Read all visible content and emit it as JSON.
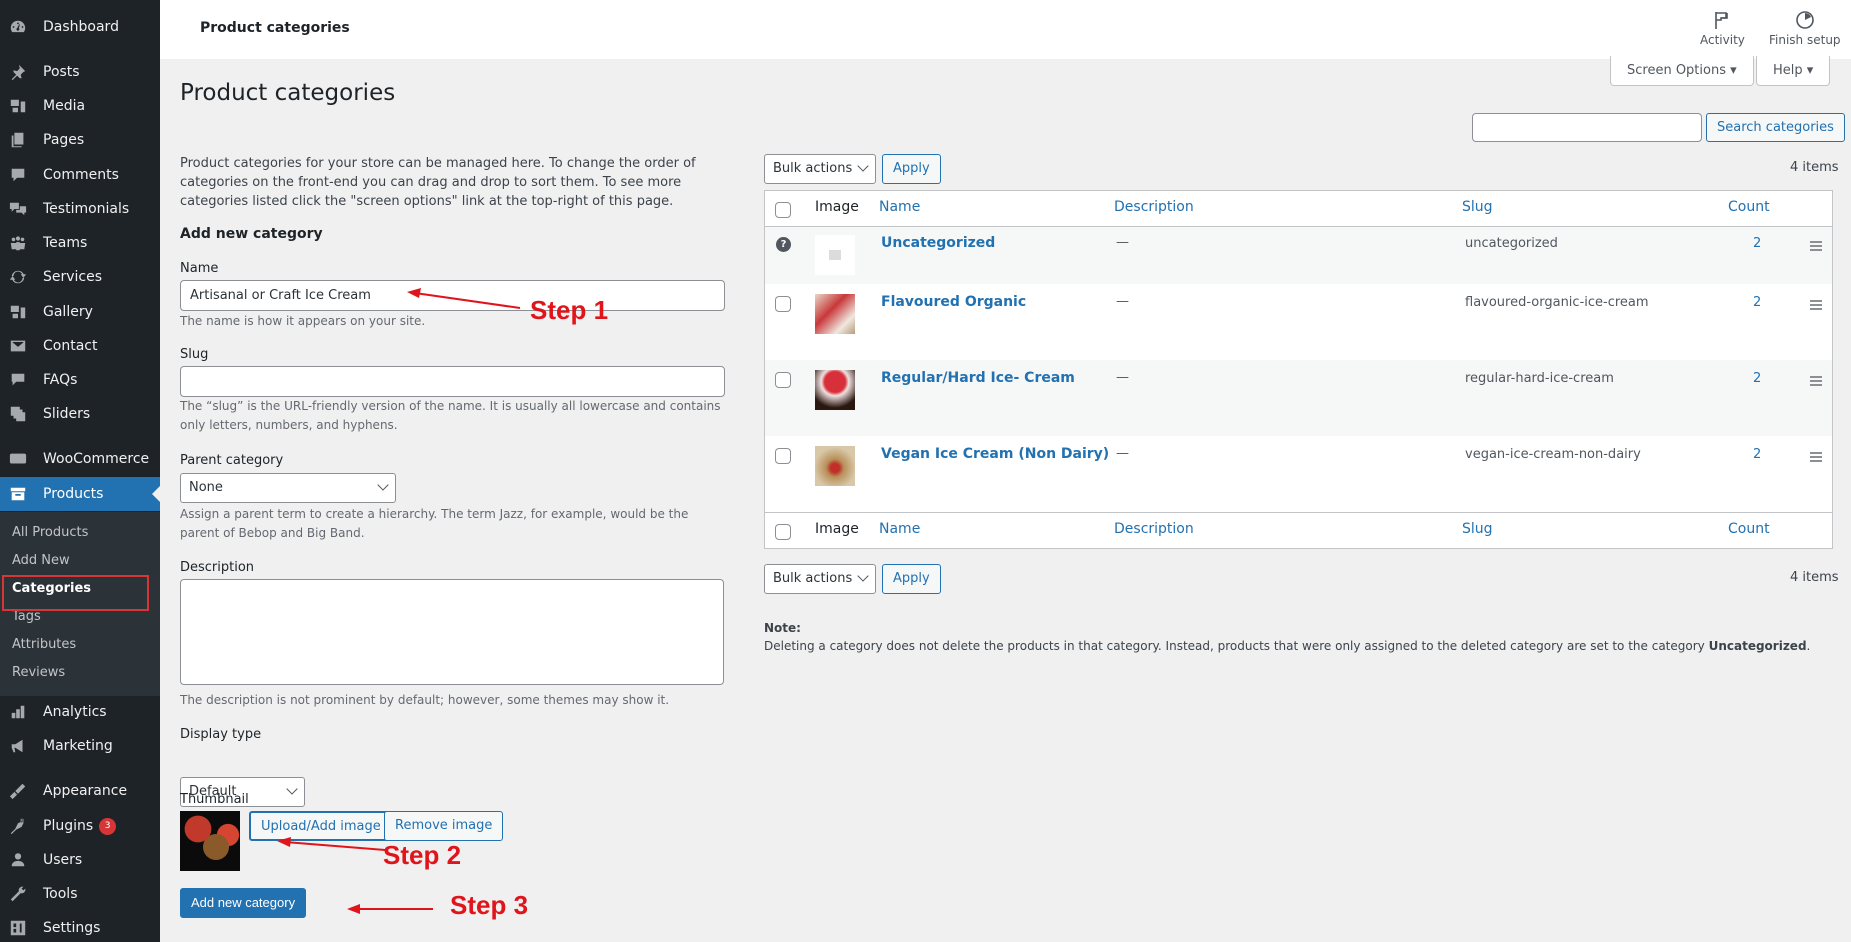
{
  "sidebar": {
    "items": [
      {
        "label": "Dashboard",
        "icon": "dashboard-icon"
      },
      {
        "label": "Posts",
        "icon": "pin-icon"
      },
      {
        "label": "Media",
        "icon": "media-icon"
      },
      {
        "label": "Pages",
        "icon": "pages-icon"
      },
      {
        "label": "Comments",
        "icon": "comment-icon"
      },
      {
        "label": "Testimonials",
        "icon": "testimonials-icon"
      },
      {
        "label": "Teams",
        "icon": "groups-icon"
      },
      {
        "label": "Services",
        "icon": "update-icon"
      },
      {
        "label": "Gallery",
        "icon": "media-icon"
      },
      {
        "label": "Contact",
        "icon": "email-icon"
      },
      {
        "label": "FAQs",
        "icon": "format-chat-icon"
      },
      {
        "label": "Sliders",
        "icon": "images-icon"
      },
      {
        "label": "WooCommerce",
        "icon": "woo-icon"
      },
      {
        "label": "Products",
        "icon": "archive-icon"
      },
      {
        "label": "Analytics",
        "icon": "chart-bar-icon"
      },
      {
        "label": "Marketing",
        "icon": "megaphone-icon"
      },
      {
        "label": "Appearance",
        "icon": "brush-icon"
      },
      {
        "label": "Plugins",
        "icon": "plugin-icon",
        "badge": "3"
      },
      {
        "label": "Users",
        "icon": "user-icon"
      },
      {
        "label": "Tools",
        "icon": "wrench-icon"
      },
      {
        "label": "Settings",
        "icon": "settings-icon"
      }
    ],
    "submenu": [
      "All Products",
      "Add New",
      "Categories",
      "Tags",
      "Attributes",
      "Reviews"
    ],
    "current_submenu": "Categories"
  },
  "topbar": {
    "title": "Product categories",
    "activity": "Activity",
    "finish_setup": "Finish setup"
  },
  "screen_options": "Screen Options ▾",
  "help": "Help ▾",
  "page_title": "Product categories",
  "intro": "Product categories for your store can be managed here. To change the order of categories on the front-end you can drag and drop to sort them. To see more categories listed click the \"screen options\" link at the top-right of this page.",
  "form": {
    "heading": "Add new category",
    "name_label": "Name",
    "name_value": "Artisanal or Craft Ice Cream",
    "name_help": "The name is how it appears on your site.",
    "slug_label": "Slug",
    "slug_value": "",
    "slug_help": "The “slug” is the URL-friendly version of the name. It is usually all lowercase and contains only letters, numbers, and hyphens.",
    "parent_label": "Parent category",
    "parent_value": "None",
    "parent_help": "Assign a parent term to create a hierarchy. The term Jazz, for example, would be the parent of Bebop and Big Band.",
    "description_label": "Description",
    "description_value": "",
    "description_help": "The description is not prominent by default; however, some themes may show it.",
    "display_type_label": "Display type",
    "display_type_value": "Default",
    "thumbnail_label": "Thumbnail",
    "upload_btn": "Upload/Add image",
    "remove_btn": "Remove image",
    "submit_btn": "Add new category"
  },
  "annotations": {
    "step1": "Step 1",
    "step2": "Step 2",
    "step3": "Step 3"
  },
  "search": {
    "value": "",
    "button": "Search categories"
  },
  "bulk": {
    "label": "Bulk actions",
    "apply": "Apply",
    "items_count": "4 items"
  },
  "table": {
    "columns": [
      "Image",
      "Name",
      "Description",
      "Slug",
      "Count"
    ],
    "rows": [
      {
        "name": "Uncategorized",
        "description": "—",
        "slug": "uncategorized",
        "count": "2",
        "default": true
      },
      {
        "name": "Flavoured Organic",
        "description": "—",
        "slug": "flavoured-organic-ice-cream",
        "count": "2"
      },
      {
        "name": "Regular/Hard Ice- Cream",
        "description": "—",
        "slug": "regular-hard-ice-cream",
        "count": "2"
      },
      {
        "name": "Vegan Ice Cream (Non Dairy)",
        "description": "—",
        "slug": "vegan-ice-cream-non-dairy",
        "count": "2"
      }
    ]
  },
  "note": {
    "title": "Note:",
    "text": "Deleting a category does not delete the products in that category. Instead, products that were only assigned to the deleted category are set to the category ",
    "bold": "Uncategorized",
    "end": "."
  }
}
